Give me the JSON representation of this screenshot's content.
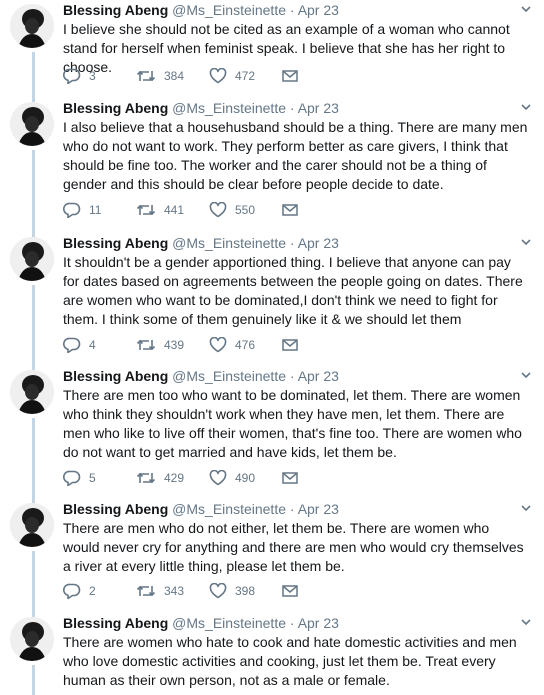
{
  "tweets": [
    {
      "name": "Blessing Abeng",
      "handle": "@Ms_Einsteinette",
      "dot": "·",
      "date": "Apr 23",
      "text": "I believe she should not be cited as an example of a woman who cannot stand for herself when feminist speak. I believe that she has her right to choose.",
      "replies": "3",
      "retweets": "384",
      "likes": "472"
    },
    {
      "name": "Blessing Abeng",
      "handle": "@Ms_Einsteinette",
      "dot": "·",
      "date": "Apr 23",
      "text": "I also believe that a househusband should be a thing. There are many men who do not want to work. They perform better as care givers, I think that should be fine too. The worker and the carer should not be a thing of gender and this should be clear before people decide to date.",
      "replies": "11",
      "retweets": "441",
      "likes": "550"
    },
    {
      "name": "Blessing Abeng",
      "handle": "@Ms_Einsteinette",
      "dot": "·",
      "date": "Apr 23",
      "text": "It shouldn't be a gender apportioned thing. I believe that anyone can pay for dates based on agreements between the people going on dates. There are women who want to be dominated,I don't think we need to fight for them. I think some of them genuinely like it & we should let them",
      "replies": "4",
      "retweets": "439",
      "likes": "476"
    },
    {
      "name": "Blessing Abeng",
      "handle": "@Ms_Einsteinette",
      "dot": "·",
      "date": "Apr 23",
      "text": "There are men too who want to be dominated, let them. There are women who think they shouldn't work when they have men, let them. There are men who like to live off their women, that's fine too. There are women who do not want to get married and have kids, let them be.",
      "replies": "5",
      "retweets": "429",
      "likes": "490"
    },
    {
      "name": "Blessing Abeng",
      "handle": "@Ms_Einsteinette",
      "dot": "·",
      "date": "Apr 23",
      "text": "There are men who do not either, let them be. There are women who would never cry for anything and there are men who would cry themselves a river at every little thing, please let them be.",
      "replies": "2",
      "retweets": "343",
      "likes": "398"
    },
    {
      "name": "Blessing Abeng",
      "handle": "@Ms_Einsteinette",
      "dot": "·",
      "date": "Apr 23",
      "text": "There are women who hate to cook and hate domestic activities and men who love domestic activities and cooking, just let them be. Treat every human as their own person, not as a male or female.",
      "replies": "",
      "retweets": "",
      "likes": ""
    }
  ],
  "icons": {
    "reply": "reply-icon",
    "retweet": "retweet-icon",
    "like": "heart-icon",
    "dm": "envelope-icon",
    "caret": "chevron-down-icon"
  },
  "colors": {
    "thread_line": "#c4d6e4",
    "icon": "#657786",
    "text": "#14171a",
    "muted": "#657786"
  }
}
